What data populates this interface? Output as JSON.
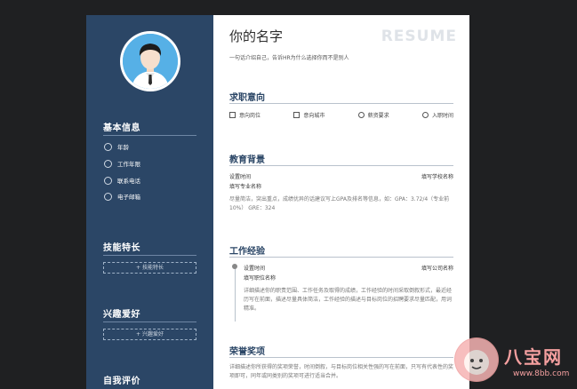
{
  "resume": {
    "name": "你的名字",
    "watermark_word": "RESUME",
    "intro": "一句话介绍自己，告诉HR为什么选择你而不是别人"
  },
  "sidebar": {
    "basic_title": "基本信息",
    "basic_items": [
      "年龄",
      "工作年限",
      "联系电话",
      "电子邮箱"
    ],
    "skills_title": "技能特长",
    "skills_button": "+ 技能特长",
    "hobby_title": "兴趣爱好",
    "hobby_button": "+ 兴趣爱好",
    "eval_title": "自我评价"
  },
  "intent": {
    "title": "求职意向",
    "items": [
      "意向岗位",
      "意向城市",
      "薪资要求",
      "入职时间"
    ]
  },
  "education": {
    "title": "教育背景",
    "time": "设置时间",
    "school": "填写学校名称",
    "major": "填写专业名称",
    "desc": "尽量简洁，突出重点，成绩优异的话建议写上GPA及排名等信息，如：GPA：3.72/4（专业前10%） GRE：324"
  },
  "work": {
    "title": "工作经验",
    "time": "设置时间",
    "company": "填写公司名称",
    "position": "填写职位名称",
    "desc": "详细描述你的职责范围、工作任务及取得的成绩，工作经验的时间采取倒叙形式，最近经历写在前面，描述尽量具体简洁，工作经验的描述与目标岗位的招聘要求尽量匹配，用词精准。"
  },
  "honors": {
    "title": "荣誉奖项",
    "desc": "详细描述你所获得的奖项荣誉，时间倒叙，与目标岗位相关性强的写在前面，只写有代表性的奖项即可，同年或同类别的奖项可进行适当合并。"
  },
  "watermark": {
    "text": "八宝网",
    "url": "www.8bb.com"
  },
  "colors": {
    "sidebar": "#2b4666",
    "accent": "#2b4666",
    "background": "#1f2022"
  }
}
